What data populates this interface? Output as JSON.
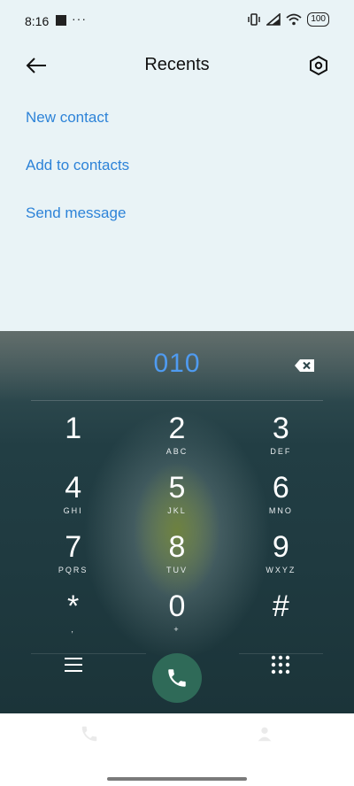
{
  "status": {
    "time": "8:16",
    "dots": "···",
    "battery": "100"
  },
  "header": {
    "title": "Recents"
  },
  "menu": [
    "New contact",
    "Add to contacts",
    "Send message"
  ],
  "dialer": {
    "number": "010",
    "keys": [
      {
        "digit": "1",
        "letters": ""
      },
      {
        "digit": "2",
        "letters": "ABC"
      },
      {
        "digit": "3",
        "letters": "DEF"
      },
      {
        "digit": "4",
        "letters": "GHI"
      },
      {
        "digit": "5",
        "letters": "JKL"
      },
      {
        "digit": "6",
        "letters": "MNO"
      },
      {
        "digit": "7",
        "letters": "PQRS"
      },
      {
        "digit": "8",
        "letters": "TUV"
      },
      {
        "digit": "9",
        "letters": "WXYZ"
      },
      {
        "digit": "*",
        "letters": ","
      },
      {
        "digit": "0",
        "letters": "+"
      },
      {
        "digit": "#",
        "letters": ""
      }
    ]
  },
  "colors": {
    "accent": "#2d83d8",
    "number": "#4f9bf0",
    "call": "#2f6a58"
  },
  "icons": [
    "back-arrow-icon",
    "settings-hexagon-icon",
    "backspace-icon",
    "menu-icon",
    "call-icon",
    "dialpad-icon"
  ]
}
